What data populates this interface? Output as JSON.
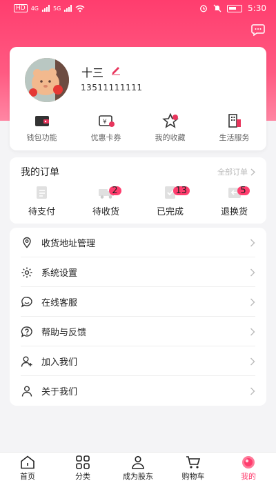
{
  "status_bar": {
    "carrier_left": "HD",
    "network_1": "4G",
    "network_2": "5G",
    "time": "5:30"
  },
  "profile": {
    "name": "十三",
    "phone": "13511111111",
    "quick_actions": [
      {
        "label": "钱包功能",
        "icon": "wallet-icon"
      },
      {
        "label": "优惠卡券",
        "icon": "coupon-icon"
      },
      {
        "label": "我的收藏",
        "icon": "star-icon"
      },
      {
        "label": "生活服务",
        "icon": "building-icon"
      }
    ]
  },
  "orders": {
    "title": "我的订单",
    "all_label": "全部订单",
    "items": [
      {
        "label": "待支付",
        "badge": "",
        "icon": "pending-payment-icon"
      },
      {
        "label": "待收货",
        "badge": "2",
        "icon": "truck-icon"
      },
      {
        "label": "已完成",
        "badge": "13",
        "icon": "completed-icon"
      },
      {
        "label": "退换货",
        "badge": "5",
        "icon": "return-icon"
      }
    ]
  },
  "menu": [
    {
      "label": "收货地址管理",
      "icon": "location-icon"
    },
    {
      "label": "系统设置",
      "icon": "settings-icon"
    },
    {
      "label": "在线客服",
      "icon": "chat-icon"
    },
    {
      "label": "帮助与反馈",
      "icon": "help-icon"
    },
    {
      "label": "加入我们",
      "icon": "add-user-icon"
    },
    {
      "label": "关于我们",
      "icon": "user-icon"
    }
  ],
  "tabbar": [
    {
      "label": "首页",
      "icon": "home-icon",
      "active": false
    },
    {
      "label": "分类",
      "icon": "grid-icon",
      "active": false
    },
    {
      "label": "成为股东",
      "icon": "group-icon",
      "active": false
    },
    {
      "label": "购物车",
      "icon": "cart-icon",
      "active": false
    },
    {
      "label": "我的",
      "icon": "profile-icon",
      "active": true
    }
  ],
  "colors": {
    "accent": "#ff3d6e",
    "icon_dark": "#333333",
    "icon_red": "#e8365d"
  }
}
